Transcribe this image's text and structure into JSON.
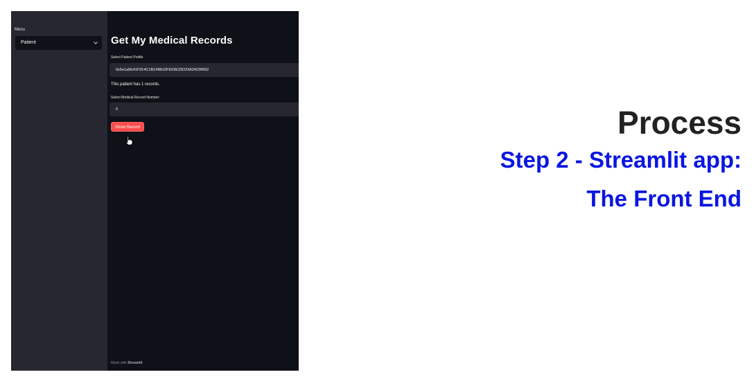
{
  "sidebar": {
    "menu_label": "Menu",
    "select_value": "Patient"
  },
  "main": {
    "title": "Get My Medical Records",
    "profile_label": "Select Patient Profile",
    "profile_value": "0x5e1a5E41F914C1B1498cDFE03E25D23A34239652",
    "record_count_text": "This patient has 1 records.",
    "record_number_label": "Select Medical Record Number:",
    "record_number_value": "0",
    "show_button_label": "Show Record",
    "footer_prefix": "Made with",
    "footer_brand": "Streamlit"
  },
  "slide": {
    "title": "Process",
    "subtitle_line1": "Step 2 - Streamlit app:",
    "subtitle_line2": "The Front End"
  },
  "colors": {
    "app_bg": "#0e1117",
    "sidebar_bg": "#262730",
    "input_bg": "#262730",
    "button_bg": "#ff4b4b",
    "slide_title": "#222222",
    "slide_subtitle": "#0a16e0"
  },
  "icons": {
    "dropdown": "chevron-down-icon",
    "pointer": "hand-cursor-icon"
  }
}
